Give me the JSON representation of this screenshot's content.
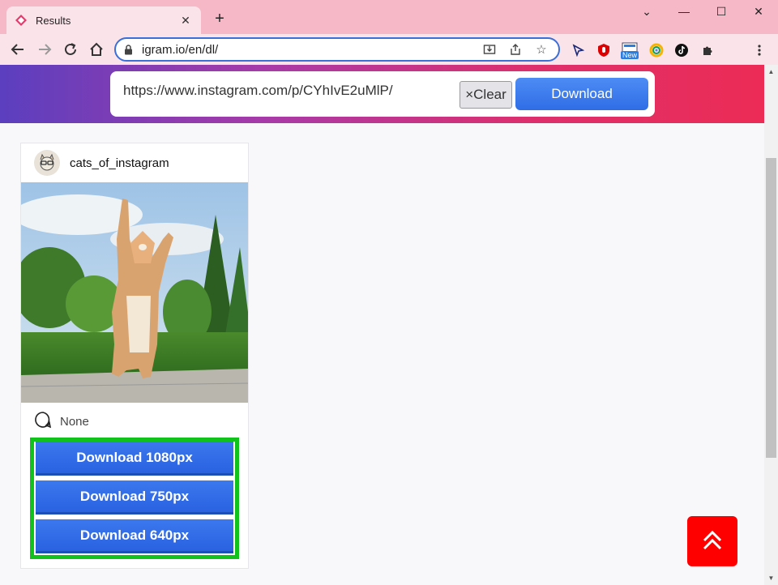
{
  "browser": {
    "tab_title": "Results",
    "url": "igram.io/en/dl/",
    "new_badge": "New"
  },
  "search": {
    "value": "https://www.instagram.com/p/CYhIvE2uMlP/",
    "clear_label": "Clear",
    "clear_glyph": "×",
    "download_label": "Download"
  },
  "post": {
    "username": "cats_of_instagram",
    "caption": "None",
    "downloads": [
      {
        "label": "Download 1080px"
      },
      {
        "label": "Download 750px"
      },
      {
        "label": "Download 640px"
      }
    ]
  },
  "colors": {
    "accent_blue": "#2f6de6",
    "highlight_green": "#12c21c",
    "scroll_top_red": "#ff0000"
  }
}
